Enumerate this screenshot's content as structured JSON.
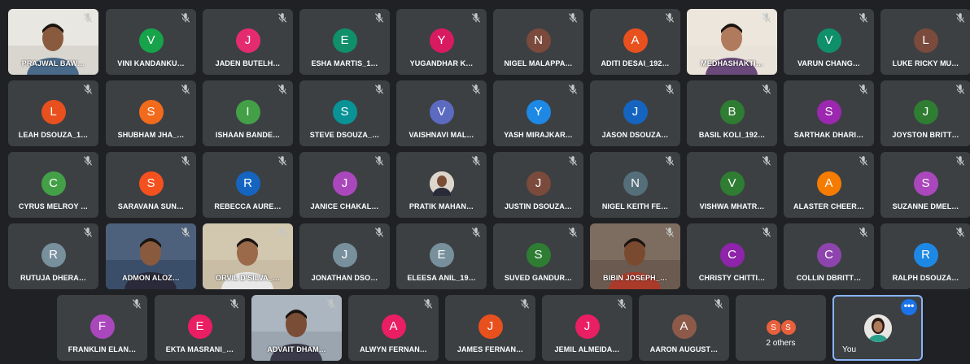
{
  "participants": [
    {
      "name": "PRAJWAL BAW…",
      "initial": "",
      "color": "",
      "photo": true,
      "photo_theme": "room-white"
    },
    {
      "name": "VINI KANDANKU…",
      "initial": "V",
      "color": "#16a34a"
    },
    {
      "name": "JADEN BUTELH…",
      "initial": "J",
      "color": "#e52b6f"
    },
    {
      "name": "ESHA MARTIS_1…",
      "initial": "E",
      "color": "#0f8f6a"
    },
    {
      "name": "YUGANDHAR K…",
      "initial": "Y",
      "color": "#d81b60"
    },
    {
      "name": "NIGEL MALAPPA…",
      "initial": "N",
      "color": "#7a4a3c"
    },
    {
      "name": "ADITI DESAI_192…",
      "initial": "A",
      "color": "#e8501e"
    },
    {
      "name": "MEDHASHAKTI…",
      "initial": "",
      "color": "",
      "photo": true,
      "photo_theme": "room-light"
    },
    {
      "name": "VARUN CHANG…",
      "initial": "V",
      "color": "#0f8f6a"
    },
    {
      "name": "LUKE RICKY MU…",
      "initial": "L",
      "color": "#7a4a3c"
    },
    {
      "name": "LEAH DSOUZA_1…",
      "initial": "L",
      "color": "#e8501e"
    },
    {
      "name": "SHUBHAM JHA_…",
      "initial": "S",
      "color": "#f26b1d"
    },
    {
      "name": "ISHAAN BANDE…",
      "initial": "I",
      "color": "#43a047"
    },
    {
      "name": "STEVE DSOUZA_…",
      "initial": "S",
      "color": "#0a9396"
    },
    {
      "name": "VAISHNAVI MAL…",
      "initial": "V",
      "color": "#5c6bc0"
    },
    {
      "name": "YASH MIRAJKAR…",
      "initial": "Y",
      "color": "#1e88e5"
    },
    {
      "name": "JASON DSOUZA…",
      "initial": "J",
      "color": "#1565c0"
    },
    {
      "name": "BASIL KOLI_192…",
      "initial": "B",
      "color": "#2e7d32"
    },
    {
      "name": "SARTHAK DHARI…",
      "initial": "S",
      "color": "#9c27b0"
    },
    {
      "name": "JOYSTON BRITT…",
      "initial": "J",
      "color": "#2e7d32"
    },
    {
      "name": "CYRUS MELROY …",
      "initial": "C",
      "color": "#43a047"
    },
    {
      "name": "SARAVANA SUN…",
      "initial": "S",
      "color": "#f4511e"
    },
    {
      "name": "REBECCA AURE…",
      "initial": "R",
      "color": "#1565c0"
    },
    {
      "name": "JANICE CHAKAL…",
      "initial": "J",
      "color": "#ab47bc"
    },
    {
      "name": "PRATIK MAHAN…",
      "initial": "",
      "color": "",
      "profile_pic": true
    },
    {
      "name": "JUSTIN DSOUZA…",
      "initial": "J",
      "color": "#7a4a3c"
    },
    {
      "name": "NIGEL KEITH FE…",
      "initial": "N",
      "color": "#546e7a"
    },
    {
      "name": "VISHWA MHATR…",
      "initial": "V",
      "color": "#2e7d32"
    },
    {
      "name": "ALASTER CHEER…",
      "initial": "A",
      "color": "#f57c00"
    },
    {
      "name": "SUZANNE DMEL…",
      "initial": "S",
      "color": "#ab47bc"
    },
    {
      "name": "RUTUJA DHERA…",
      "initial": "R",
      "color": "#78909c"
    },
    {
      "name": "ADMON ALOZ…",
      "initial": "",
      "color": "",
      "photo": true,
      "photo_theme": "room-blue"
    },
    {
      "name": "ORVIL D'SILVA_…",
      "initial": "",
      "color": "",
      "photo": true,
      "photo_theme": "room-beige"
    },
    {
      "name": "JONATHAN DSO…",
      "initial": "J",
      "color": "#78909c"
    },
    {
      "name": "ELEESA ANIL_19…",
      "initial": "E",
      "color": "#78909c"
    },
    {
      "name": "SUVED GANDUR…",
      "initial": "S",
      "color": "#2e7d32"
    },
    {
      "name": "BIBIN JOSEPH_…",
      "initial": "",
      "color": "",
      "photo": true,
      "photo_theme": "room-dark"
    },
    {
      "name": "CHRISTY CHITTI…",
      "initial": "C",
      "color": "#8e24aa"
    },
    {
      "name": "COLLIN DBRITT…",
      "initial": "C",
      "color": "#8e44ad"
    },
    {
      "name": "RALPH DSOUZA…",
      "initial": "R",
      "color": "#1e88e5"
    },
    {
      "name": "FRANKLIN ELAN…",
      "initial": "F",
      "color": "#ab47bc"
    },
    {
      "name": "EKTA MASRANI_…",
      "initial": "E",
      "color": "#e91e63"
    },
    {
      "name": "ADVAIT DHAM…",
      "initial": "",
      "color": "",
      "photo": true,
      "photo_theme": "room-closeup"
    },
    {
      "name": "ALWYN FERNAN…",
      "initial": "A",
      "color": "#e91e63"
    },
    {
      "name": "JAMES FERNAN…",
      "initial": "J",
      "color": "#e8501e"
    },
    {
      "name": "JEMIL ALMEIDA…",
      "initial": "J",
      "color": "#e91e63"
    },
    {
      "name": "AARON AUGUST…",
      "initial": "A",
      "color": "#8d5a4a"
    }
  ],
  "others": {
    "label": "2 others",
    "initials": [
      "S",
      "S"
    ],
    "color": "#e8603c"
  },
  "you": {
    "label": "You",
    "menu_glyph": "•••",
    "accent": "#1a73e8"
  },
  "colors": {
    "background": "#202124",
    "tile": "#3c4043",
    "mic_icon": "#c4c7c5"
  }
}
